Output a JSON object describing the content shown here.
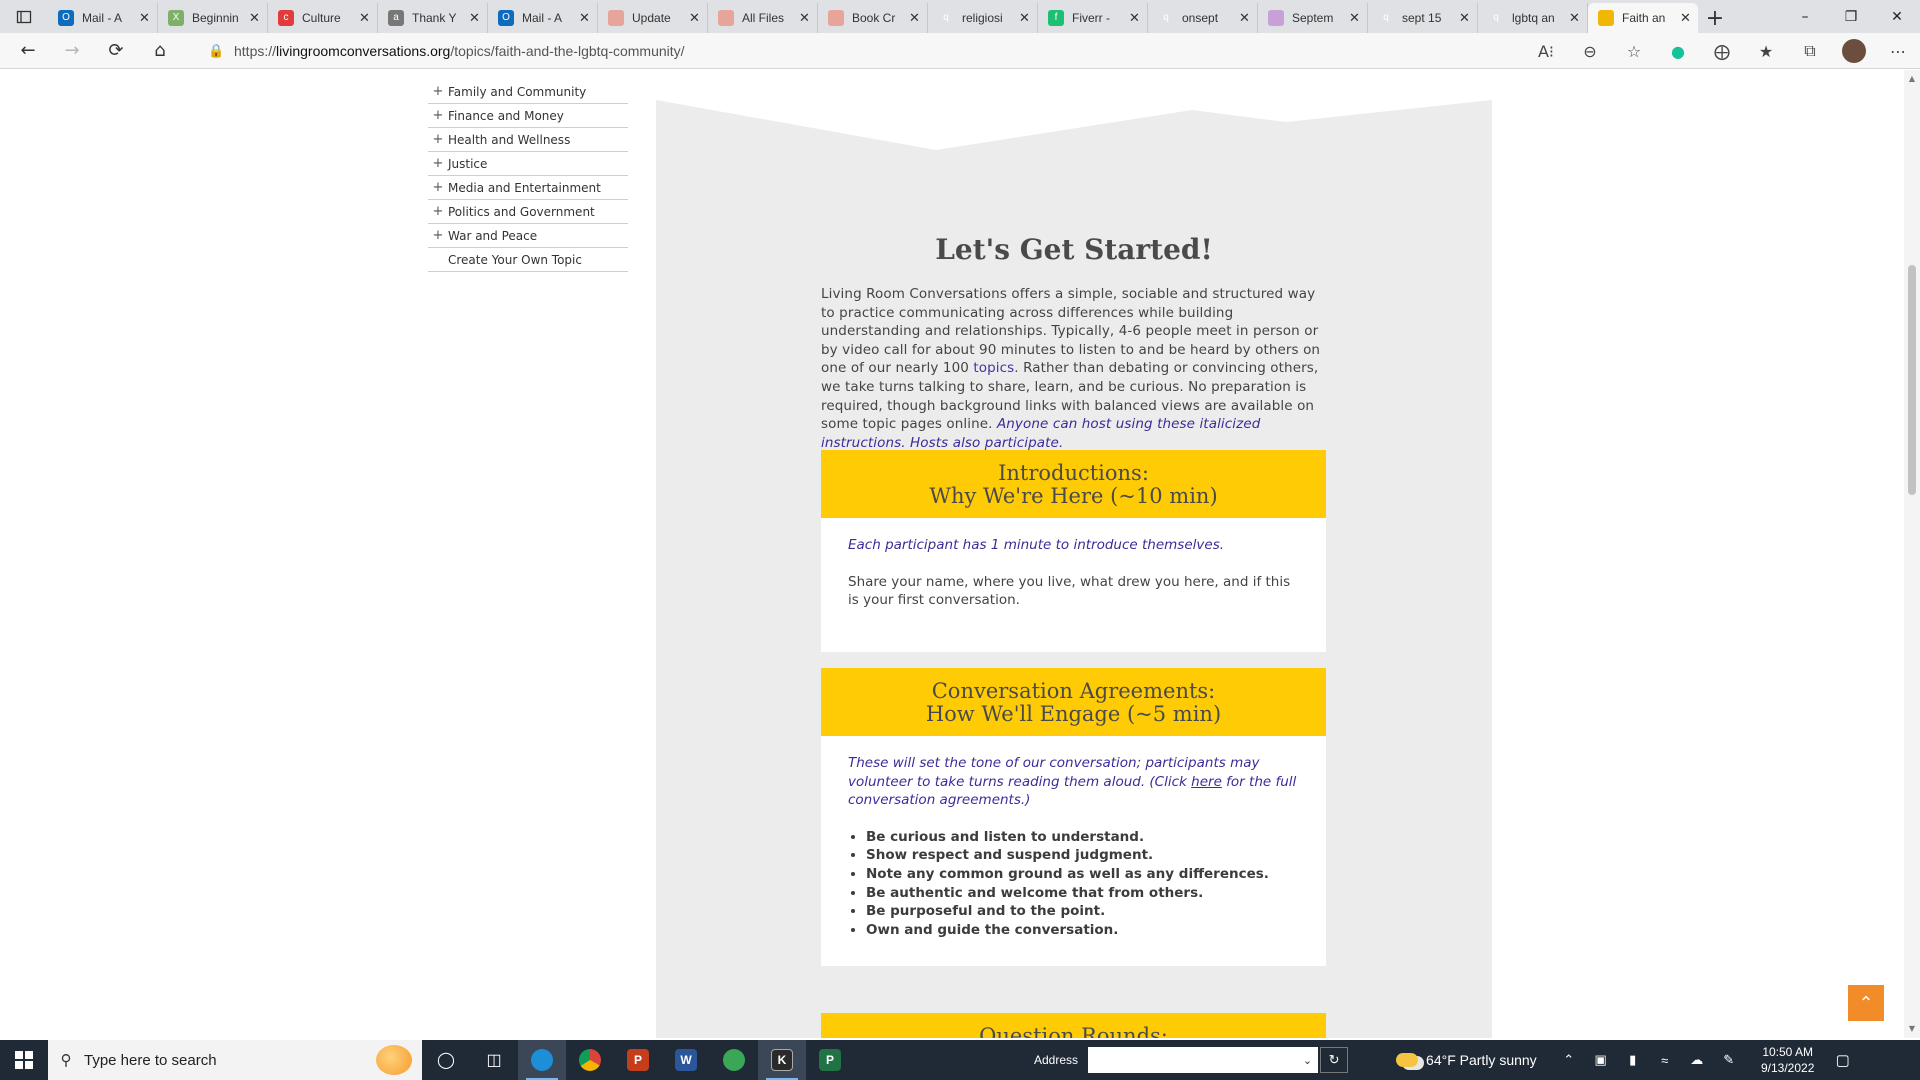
{
  "browser": {
    "tabs": [
      {
        "title": "Mail - A",
        "color": "#0f6cbd",
        "glyph": "O"
      },
      {
        "title": "Beginnin",
        "color": "#7fb069",
        "glyph": "X"
      },
      {
        "title": "Culture",
        "color": "#e23b3b",
        "glyph": "c"
      },
      {
        "title": "Thank Y",
        "color": "#777777",
        "glyph": "a"
      },
      {
        "title": "Mail - A",
        "color": "#0f6cbd",
        "glyph": "O"
      },
      {
        "title": "Update",
        "color": "#e7a49b",
        "glyph": ""
      },
      {
        "title": "All Files",
        "color": "#e7a49b",
        "glyph": ""
      },
      {
        "title": "Book Cr",
        "color": "#e7a49b",
        "glyph": ""
      },
      {
        "title": "religiosi",
        "color": "#dfe1e5",
        "glyph": "q"
      },
      {
        "title": "Fiverr -",
        "color": "#1dbf73",
        "glyph": "f"
      },
      {
        "title": "onsept",
        "color": "#dfe1e5",
        "glyph": "q"
      },
      {
        "title": "Septem",
        "color": "#c6a0d6",
        "glyph": ""
      },
      {
        "title": "sept 15",
        "color": "#dfe1e5",
        "glyph": "q"
      },
      {
        "title": "lgbtq an",
        "color": "#dfe1e5",
        "glyph": "q"
      },
      {
        "title": "Faith an",
        "color": "#f2b705",
        "glyph": ""
      }
    ],
    "active_tab": 14,
    "url_prefix": "https://",
    "url_host": "livingroomconversations.org",
    "url_path": "/topics/faith-and-the-lgbtq-community/"
  },
  "sidebar": {
    "items": [
      {
        "label": "Family and Community",
        "expandable": true
      },
      {
        "label": "Finance and Money",
        "expandable": true
      },
      {
        "label": "Health and Wellness",
        "expandable": true
      },
      {
        "label": "Justice",
        "expandable": true
      },
      {
        "label": "Media and Entertainment",
        "expandable": true
      },
      {
        "label": "Politics and Government",
        "expandable": true
      },
      {
        "label": "War and Peace",
        "expandable": true
      },
      {
        "label": "Create Your Own Topic",
        "expandable": false
      }
    ]
  },
  "main": {
    "heading": "Let's Get Started!",
    "intro_before_link": "Living Room Conversations offers a simple, sociable and structured way to practice communicating across differences while building understanding and relationships. Typically, 4-6 people meet in person or by video call for about 90 minutes to listen to and be heard by others on one of our nearly 100 ",
    "intro_link": "topics",
    "intro_after_link": ". Rather than debating or convincing others, we take turns talking to share, learn, and be curious. No preparation is required, though background links with balanced views are available on some topic pages online. ",
    "intro_italic": "Anyone can host using these italicized instructions. Hosts also participate.",
    "sections": [
      {
        "title_line1": "Introductions:",
        "title_line2": "Why We're Here (~10 min)",
        "lead": "Each participant has 1 minute to introduce themselves.",
        "text": "Share your name, where you live, what drew you here, and if this is your first conversation."
      },
      {
        "title_line1": "Conversation Agreements:",
        "title_line2": "How We'll Engage (~5 min)",
        "lead_before_link": "These will set the tone of our conversation; participants may volunteer to take turns reading them aloud. (Click ",
        "lead_link": "here",
        "lead_after_link": " for the full conversation agreements.)",
        "agreements": [
          "Be curious and listen to understand.",
          "Show respect and suspend judgment.",
          "Note any common ground as well as any differences.",
          "Be authentic and welcome that from others.",
          "Be purposeful and to the point.",
          "Own and guide the conversation."
        ]
      },
      {
        "title_line1": "Question Rounds:"
      }
    ]
  },
  "taskbar": {
    "search_placeholder": "Type here to search",
    "address_label": "Address",
    "weather": "64°F  Partly sunny",
    "time": "10:50 AM",
    "date": "9/13/2022"
  },
  "colors": {
    "accent_band": "#ffcb05",
    "panel_bg": "#ececec",
    "italic_text": "#3a2d9a",
    "back_to_top": "#f28c28"
  }
}
